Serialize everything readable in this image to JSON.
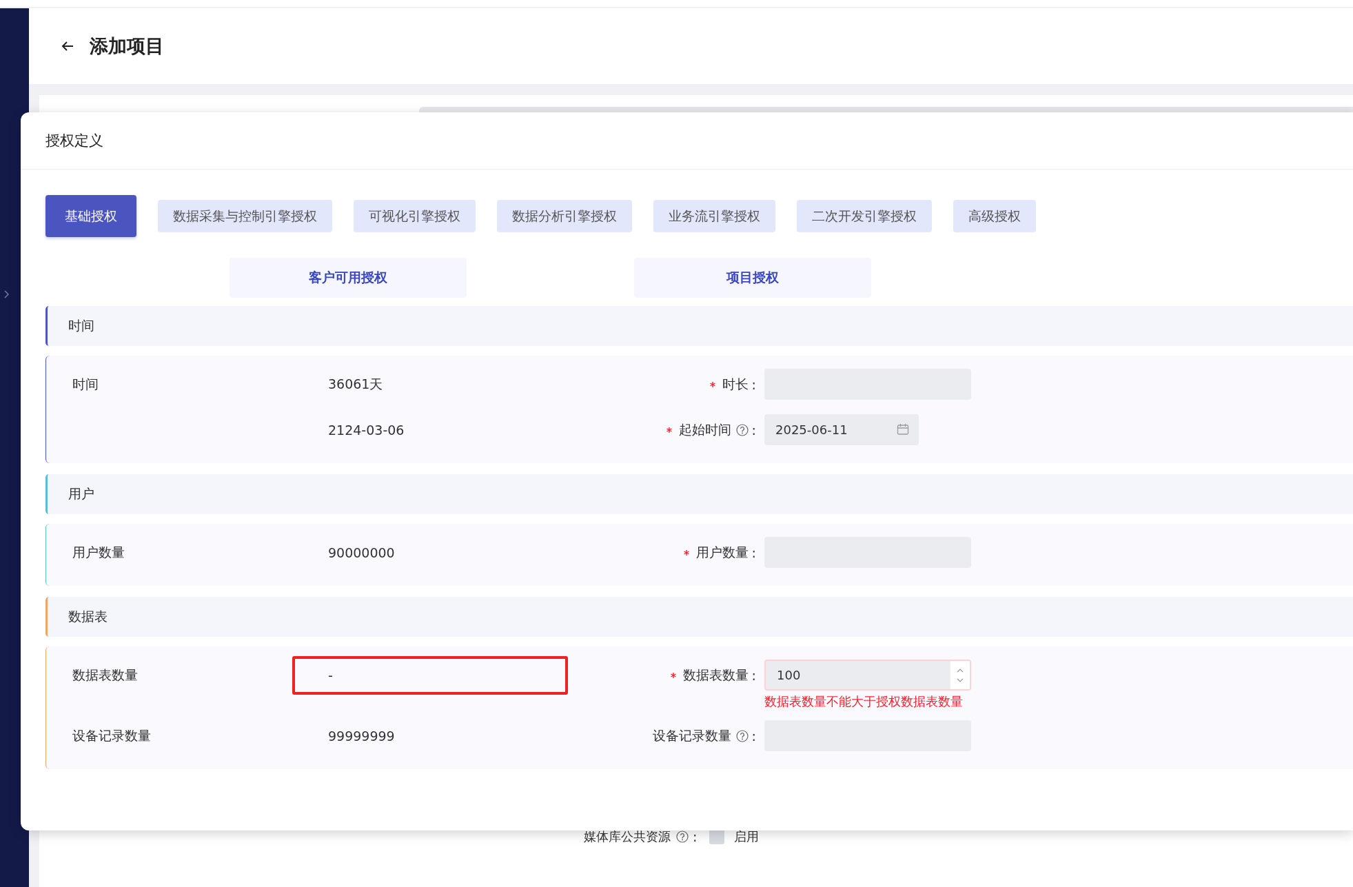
{
  "page": {
    "title": "添加项目"
  },
  "modal": {
    "title": "授权定义",
    "tabs": [
      {
        "label": "基础授权",
        "selected": true
      },
      {
        "label": "数据采集与控制引擎授权",
        "selected": false
      },
      {
        "label": "可视化引擎授权",
        "selected": false
      },
      {
        "label": "数据分析引擎授权",
        "selected": false
      },
      {
        "label": "业务流引擎授权",
        "selected": false
      },
      {
        "label": "二次开发引擎授权",
        "selected": false
      },
      {
        "label": "高级授权",
        "selected": false
      }
    ],
    "subtabs": [
      {
        "label": "客户可用授权"
      },
      {
        "label": "项目授权"
      }
    ],
    "sections": [
      {
        "title": "时间",
        "color": "#4a55c8",
        "rows": [
          {
            "label": "时间",
            "value": "36061天",
            "highlighted": false,
            "field": {
              "label": "时长",
              "suffix": ":",
              "required": true,
              "help": false,
              "kind": "text"
            }
          },
          {
            "value": "2124-03-06",
            "highlighted": false,
            "field": {
              "label": "起始时间",
              "suffix": ":",
              "required": true,
              "help": true,
              "kind": "date",
              "value": "2025-06-11"
            }
          }
        ]
      },
      {
        "title": "用户",
        "color": "#5bbcd8",
        "rows": [
          {
            "label": "用户数量",
            "value": "90000000",
            "highlighted": false,
            "field": {
              "label": "用户数量",
              "suffix": ":",
              "required": true,
              "help": false,
              "kind": "text"
            }
          }
        ]
      },
      {
        "title": "数据表",
        "color": "#f0a468",
        "rows": [
          {
            "label": "数据表数量",
            "value": "-",
            "highlighted": true,
            "field": {
              "label": "数据表数量",
              "suffix": ":",
              "required": true,
              "help": false,
              "kind": "number",
              "value": "100",
              "error": "数据表数量不能大于授权数据表数量"
            }
          },
          {
            "label": "设备记录数量",
            "value": "99999999",
            "highlighted": false,
            "field": {
              "label": "设备记录数量",
              "suffix": ":",
              "required": false,
              "help": true,
              "kind": "text"
            }
          }
        ]
      }
    ]
  },
  "background_form": {
    "label": "媒体库公共资源",
    "suffix": ":",
    "help": true,
    "checkbox": {
      "label": "启用",
      "checked": false
    }
  }
}
